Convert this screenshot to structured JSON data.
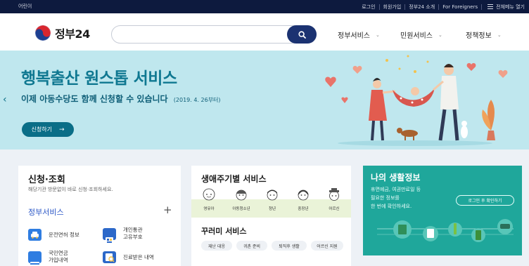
{
  "topbar": {
    "left_label": "어린이",
    "links": [
      "로그인",
      "회원가입",
      "정부24 소개",
      "For Foreigners"
    ],
    "menu_all": "전체메뉴 열기"
  },
  "header": {
    "logo_text": "정부24",
    "search_placeholder": "",
    "nav": [
      "정부서비스",
      "민원서비스",
      "정책정보"
    ]
  },
  "hero": {
    "title": "행복출산 원스톱 서비스",
    "subtitle": "이제 아동수당도 함께 신청할 수 있습니다",
    "subtitle_date": "(2019. 4. 26부터)",
    "button_label": "신청하기",
    "button_arrow": "→",
    "prev_arrow": "‹"
  },
  "card_apply": {
    "title": "신청·조회",
    "desc": "해당기관 방문없이 바로 신청·조회하세요.",
    "subheading": "정부서비스",
    "plus": "+",
    "services": [
      {
        "label": "운전면허 정보",
        "icon": "car-icon",
        "color": "#2f7de1"
      },
      {
        "label": "개인통관\n고유부호",
        "icon": "customs-icon",
        "color": "#2c68c9"
      },
      {
        "label": "국민연금\n가입내역",
        "icon": "pension-card-icon",
        "color": "#2f7de1"
      },
      {
        "label": "진료받은 내역",
        "icon": "medical-record-icon",
        "color": "#2c68c9"
      }
    ]
  },
  "card_lifecycle": {
    "title": "생애주기별 서비스",
    "stages": [
      "영유아",
      "아동청소년",
      "청년",
      "중장년",
      "어르신"
    ],
    "title2": "꾸러미 서비스",
    "tags": [
      "재난 대응",
      "귀촌 준비",
      "퇴직후 생활",
      "어르신 지원"
    ]
  },
  "card_myinfo": {
    "title": "나의 생활정보",
    "desc": "휴면예금, 여권만료일 등\n필요한 정보를\n한 번에 확인하세요.",
    "login_button": "로그인 후 확인하기"
  },
  "colors": {
    "topbar": "#0d1a3e",
    "search_button": "#1b3271",
    "hero_bg": "#bfe7ee",
    "hero_title": "#0f7891",
    "hero_button": "#0a6e87",
    "section_bg": "#edf1f6",
    "accent_blue": "#2a56c6",
    "myinfo_bg": "#1fa79b"
  }
}
